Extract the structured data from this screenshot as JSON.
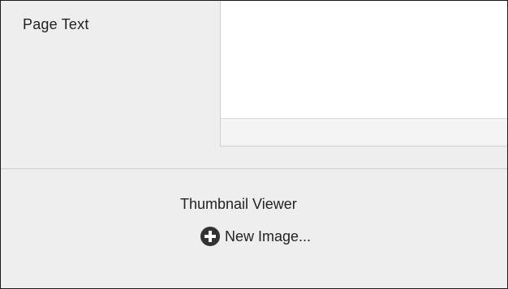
{
  "page_text": {
    "label": "Page Text"
  },
  "thumbnail_viewer": {
    "label": "Thumbnail Viewer",
    "new_image": {
      "label": "New Image...",
      "icon": "plus-circle-icon"
    }
  },
  "colors": {
    "background": "#eeeeee",
    "editor_background": "#ffffff",
    "icon": "#333333"
  }
}
